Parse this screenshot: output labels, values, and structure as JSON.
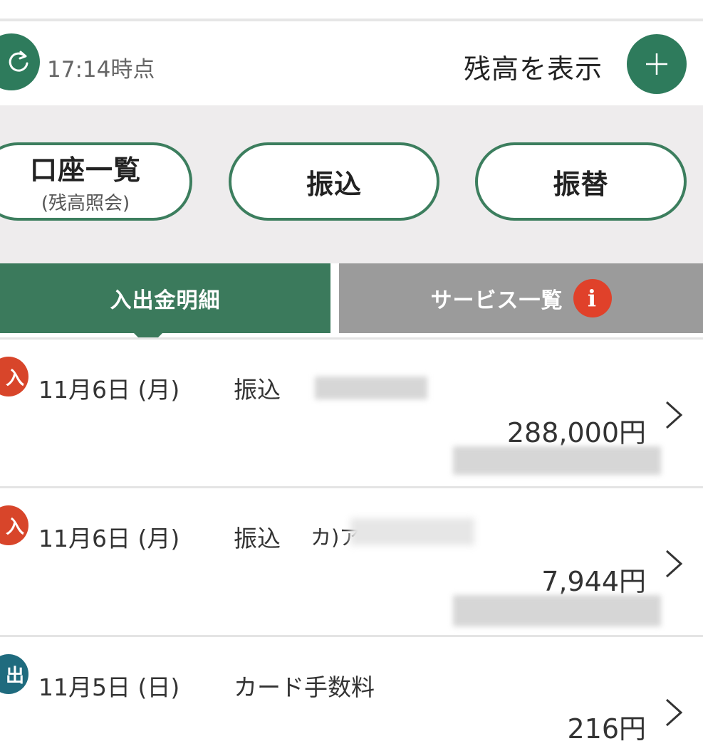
{
  "header": {
    "timestamp": "17:14時点",
    "balance_toggle_label": "残高を表示"
  },
  "quick_actions": [
    {
      "title": "口座一覧",
      "subtitle": "(残高照会)"
    },
    {
      "title": "振込"
    },
    {
      "title": "振替"
    }
  ],
  "tabs": [
    {
      "label": "入出金明細",
      "active": true
    },
    {
      "label": "サービス一覧",
      "badge": "i"
    }
  ],
  "transactions": [
    {
      "badge": "入",
      "kind": "deposit",
      "date": "11月6日 (月)",
      "type": "振込",
      "payee": "",
      "amount": "288,000円"
    },
    {
      "badge": "入",
      "kind": "deposit",
      "date": "11月6日 (月)",
      "type": "振込",
      "payee": "カ)ア",
      "amount": "7,944円"
    },
    {
      "badge": "出",
      "kind": "withdrawal",
      "date": "11月5日 (日)",
      "type": "カード手数料",
      "payee": "",
      "amount": "216円"
    }
  ],
  "colors": {
    "brand_green": "#2e7b5c",
    "tab_inactive": "#9b9b9b",
    "deposit_badge": "#d8452a",
    "withdrawal_badge": "#1f6b7e",
    "info_badge": "#e0412a"
  }
}
